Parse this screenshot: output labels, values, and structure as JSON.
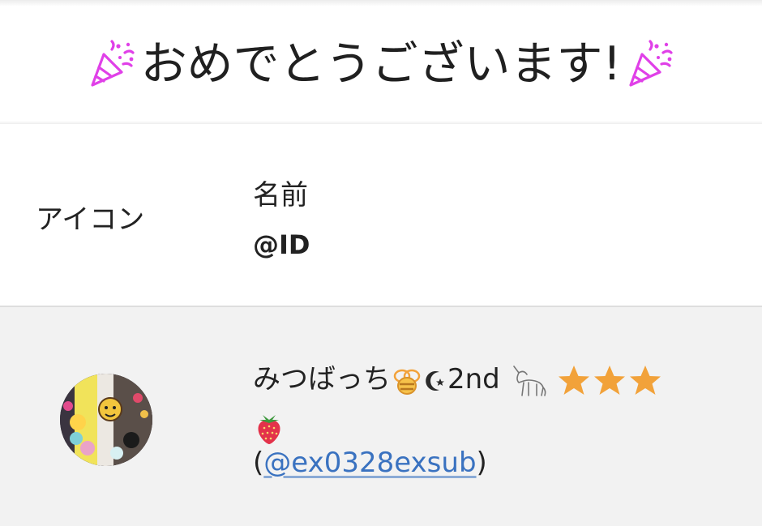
{
  "header": {
    "title": "おめでとうございます!",
    "left_icon": "party-popper-icon",
    "right_icon": "party-popper-icon",
    "accent_color": "#e040e8"
  },
  "table": {
    "headers": {
      "icon_label": "アイコン",
      "name_label": "名前",
      "id_label": "@ID"
    },
    "rows": [
      {
        "avatar": "user-avatar",
        "name_text": "みつばっち",
        "name_suffix": "2nd",
        "name_icons": [
          "honeybee-icon",
          "crescent-star-icon",
          "unicorn-icon",
          "star-icon",
          "star-icon",
          "star-icon",
          "strawberry-icon"
        ],
        "id_open": "(",
        "id_handle": "@ex0328exsub",
        "id_close": ")"
      }
    ]
  },
  "colors": {
    "link": "#3a72c0",
    "star": "#f2a23a",
    "row_bg": "#f2f2f2",
    "header_bg": "#ffffff"
  }
}
